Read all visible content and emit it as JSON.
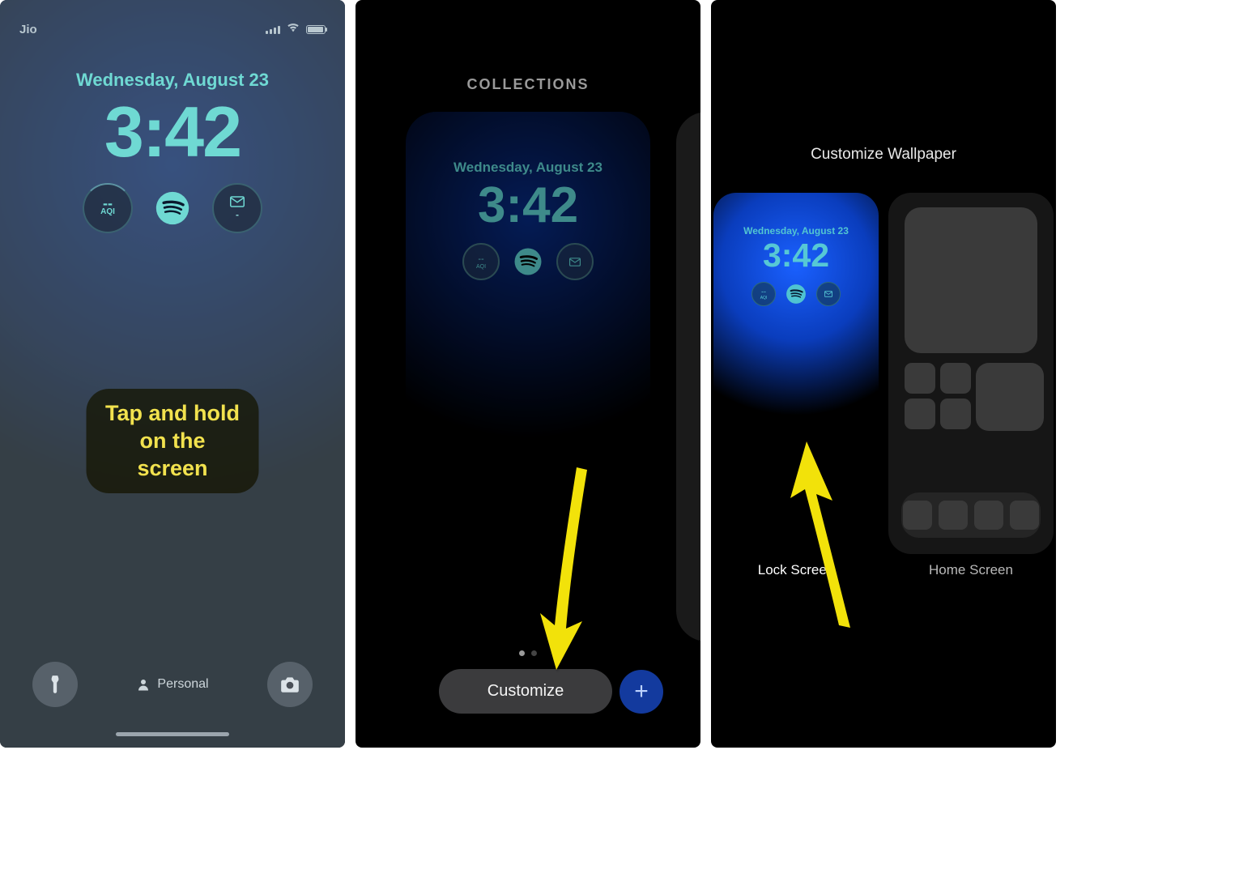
{
  "panel1": {
    "status": {
      "carrier": "Jio"
    },
    "date": "Wednesday, August 23",
    "time": "3:42",
    "widgets": {
      "aqi": "AQI",
      "aqi_dash": "--"
    },
    "callout_line1": "Tap and hold",
    "callout_line2": "on the screen",
    "focus": "Personal"
  },
  "panel2": {
    "title": "COLLECTIONS",
    "date": "Wednesday, August 23",
    "time": "3:42",
    "widgets": {
      "aqi": "AQI"
    },
    "customize": "Customize",
    "plus": "+"
  },
  "panel3": {
    "title": "Customize Wallpaper",
    "date": "Wednesday, August 23",
    "time": "3:42",
    "lock_label": "Lock Screen",
    "home_label": "Home Screen"
  }
}
